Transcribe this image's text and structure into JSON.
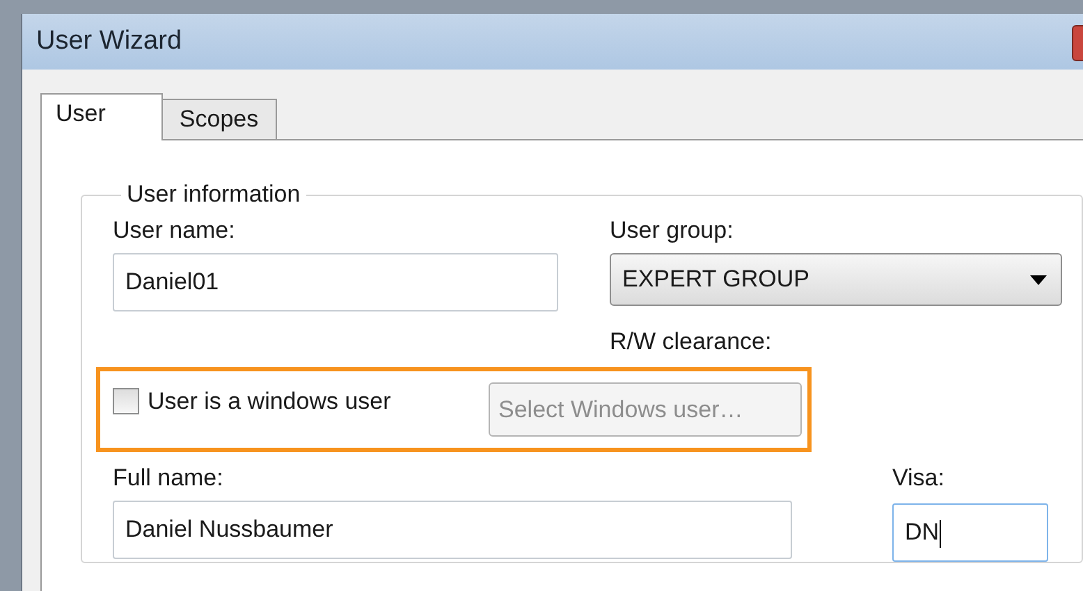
{
  "window": {
    "title": "User Wizard"
  },
  "tabs": [
    {
      "label": "User",
      "selected": true
    },
    {
      "label": "Scopes",
      "selected": false
    }
  ],
  "group": {
    "title": "User  information",
    "user_name": {
      "label": "User name:",
      "value": "Daniel01"
    },
    "user_group": {
      "label": "User group:",
      "value": "EXPERT GROUP"
    },
    "rw_clearance": {
      "label": "R/W clearance:"
    },
    "windows_user": {
      "label": "User is a windows user",
      "checked": false
    },
    "select_windows_user": {
      "label": "Select Windows user…",
      "disabled": true
    },
    "full_name": {
      "label": "Full name:",
      "value": "Daniel Nussbaumer"
    },
    "visa": {
      "label": "Visa:",
      "value": "DN",
      "focused": true
    }
  }
}
